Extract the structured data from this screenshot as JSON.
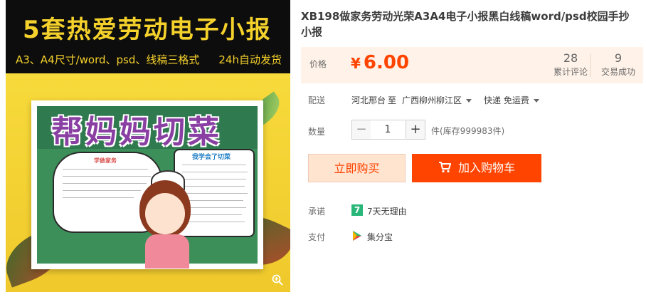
{
  "product_image": {
    "banner_title": "5套热爱劳动电子小报",
    "banner_sub_prefix": "A3、A4尺寸/word、psd、",
    "banner_sub_highlight": "线稿",
    "banner_sub_suffix": "三格式",
    "banner_ship": "24h自动发货",
    "poster_title": "帮妈妈切菜",
    "poster_panel_title": "我学会了切菜",
    "poster_cloud_title": "学做家务"
  },
  "product": {
    "title": "XB198做家务劳动光荣A3A4电子小报黑白线稿word/psd校园手抄小报"
  },
  "price": {
    "label": "价格",
    "currency": "¥",
    "value": "6.00",
    "reviews_count": "28",
    "reviews_label": "累计评论",
    "deals_count": "9",
    "deals_label": "交易成功"
  },
  "shipping": {
    "label": "配送",
    "from": "河北邢台",
    "to_word": "至",
    "destination": "广西柳州柳江区",
    "method": "快递 免运费"
  },
  "quantity": {
    "label": "数量",
    "minus": "−",
    "value": "1",
    "plus": "+",
    "stock": "件(库存999983件)"
  },
  "actions": {
    "buy_now": "立即购买",
    "add_to_cart": "加入购物车"
  },
  "promise": {
    "label": "承诺",
    "badge": "7",
    "text": "7天无理由"
  },
  "payment": {
    "label": "支付",
    "text": "集分宝"
  },
  "colors": {
    "accent": "#ff4400",
    "price_bg": "#fff2e8",
    "promise_green": "#28b779"
  }
}
